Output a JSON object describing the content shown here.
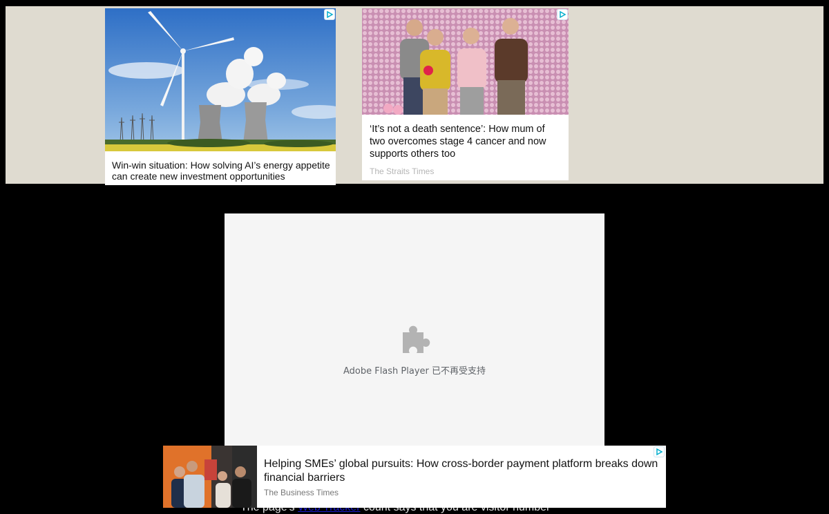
{
  "ads": {
    "card1": {
      "headline": "Win-win situation: How solving AI’s energy appetite can create new investment opportunities",
      "image_icon": "wind-turbine-cooling-towers-photo"
    },
    "card2": {
      "headline": "‘It’s not a death sentence’: How mum of two overcomes stage 4 cancer and now supports others too",
      "source": "The Straits Times",
      "image_icon": "family-photo"
    },
    "banner": {
      "headline": "Helping SMEs’ global pursuits: How cross-border payment platform breaks down financial barriers",
      "source": "The Business Times",
      "image_icon": "event-people-photo"
    },
    "adchoices_icon": "adchoices-icon",
    "adchoices_color": "#00aecd"
  },
  "flash": {
    "message": "Adobe Flash Player 已不再受支持",
    "icon": "puzzle-piece-icon"
  },
  "counter": {
    "prefix": "The page's",
    "link": "Web Tracker",
    "suffix": "count says that you are visitor number"
  },
  "colors": {
    "page_bg": "#000000",
    "ad_band_bg": "#dfdbd0",
    "flash_bg": "#f5f5f5"
  }
}
